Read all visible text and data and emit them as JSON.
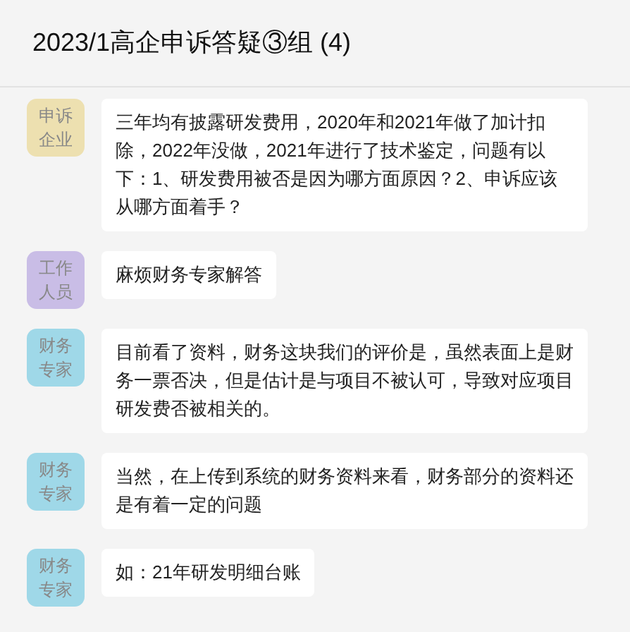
{
  "window": {
    "title": "2023/1高企申诉答疑③组 (4)"
  },
  "messages": [
    {
      "sender": "申诉企业",
      "color": "#ede0b0",
      "text": "三年均有披露研发费用，2020年和2021年做了加计扣除，2022年没做，2021年进行了技术鉴定，问题有以下：1、研发费用被否是因为哪方面原因？2、申诉应该从哪方面着手？"
    },
    {
      "sender": "工作人员",
      "color": "#c9bde6",
      "text": "麻烦财务专家解答"
    },
    {
      "sender": "财务专家",
      "color": "#9fd8e8",
      "text": "目前看了资料，财务这块我们的评价是，虽然表面上是财务一票否决，但是估计是与项目不被认可，导致对应项目研发费否被相关的。"
    },
    {
      "sender": "财务专家",
      "color": "#9fd8e8",
      "text": "当然，在上传到系统的财务资料来看，财务部分的资料还是有着一定的问题"
    },
    {
      "sender": "财务专家",
      "color": "#9fd8e8",
      "text": "如：21年研发明细台账"
    }
  ]
}
